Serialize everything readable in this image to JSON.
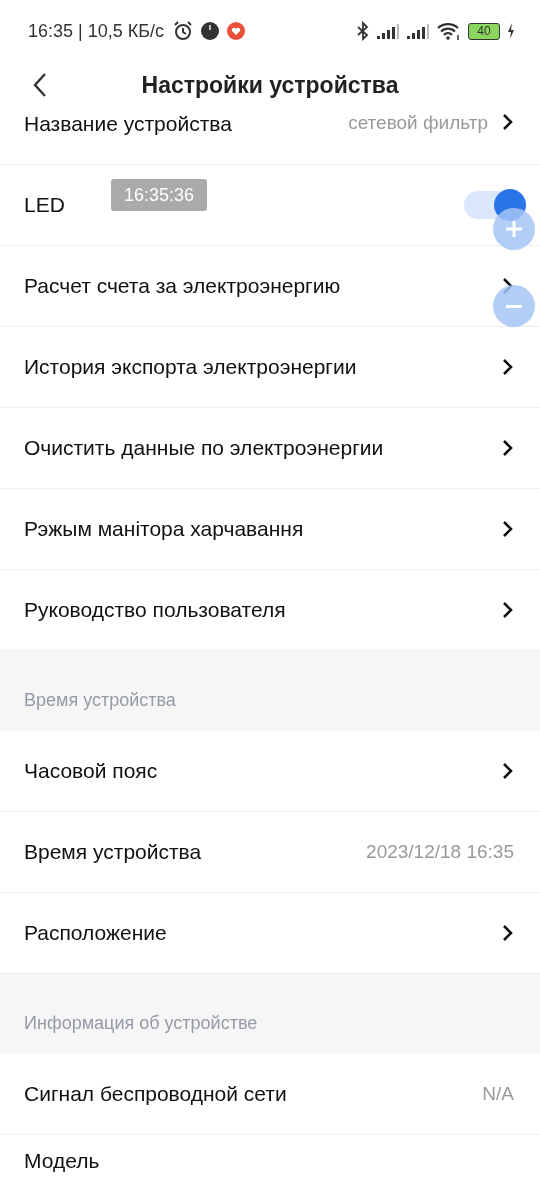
{
  "status_bar": {
    "time_speed": "16:35 | 10,5 КБ/с",
    "battery": "40"
  },
  "header": {
    "title": "Настройки устройства"
  },
  "sections": [
    {
      "items": [
        {
          "kind": "value_chevron",
          "label": "Название устройства",
          "value": "сетевой фильтр"
        },
        {
          "kind": "toggle",
          "label": "LED",
          "on": true
        },
        {
          "kind": "chevron",
          "label": "Расчет счета за электроэнергию"
        },
        {
          "kind": "chevron",
          "label": "История экспорта электроэнергии"
        },
        {
          "kind": "chevron",
          "label": "Очистить данные по электроэнергии"
        },
        {
          "kind": "chevron",
          "label": "Рэжым манітора харчавання"
        },
        {
          "kind": "chevron",
          "label": "Руководство пользователя"
        }
      ]
    },
    {
      "title": "Время устройства",
      "items": [
        {
          "kind": "chevron",
          "label": "Часовой пояс"
        },
        {
          "kind": "value",
          "label": "Время устройства",
          "value": "2023/12/18 16:35"
        },
        {
          "kind": "chevron",
          "label": "Расположение"
        }
      ]
    },
    {
      "title": "Информация об устройстве",
      "items": [
        {
          "kind": "value",
          "label": "Сигнал беспроводной сети",
          "value": "N/A"
        },
        {
          "kind": "plain",
          "label": "Модель"
        }
      ]
    }
  ],
  "toast": {
    "text": "16:35:36"
  }
}
